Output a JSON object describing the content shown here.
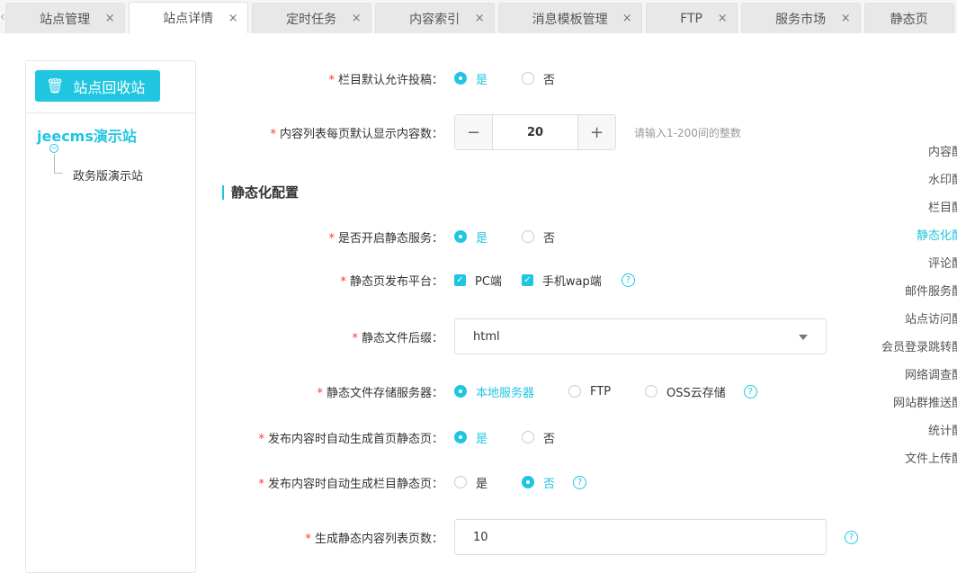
{
  "tabs": [
    {
      "label": "站点管理",
      "w": 133
    },
    {
      "label": "站点详情",
      "w": 133,
      "active": true
    },
    {
      "label": "定时任务",
      "w": 133
    },
    {
      "label": "内容索引",
      "w": 133
    },
    {
      "label": "消息模板管理",
      "w": 160
    },
    {
      "label": "FTP",
      "w": 102
    },
    {
      "label": "服务市场",
      "w": 133
    },
    {
      "label": "静态页",
      "w": 100
    }
  ],
  "sidebar": {
    "recycle_label": "站点回收站",
    "site": "jeecms演示站",
    "child": "政务版演示站"
  },
  "form": {
    "allow_submit": {
      "label": "栏目默认允许投稿：",
      "yes": "是",
      "no": "否"
    },
    "page_size": {
      "label": "内容列表每页默认显示内容数：",
      "value": "20",
      "hint": "请输入1-200间的整数",
      "minus": "−",
      "plus": "+"
    },
    "section": "静态化配置",
    "static_service": {
      "label": "是否开启静态服务：",
      "yes": "是",
      "no": "否"
    },
    "platform": {
      "label": "静态页发布平台：",
      "pc": "PC端",
      "wap": "手机wap端"
    },
    "suffix": {
      "label": "静态文件后缀：",
      "value": "html"
    },
    "storage": {
      "label": "静态文件存储服务器：",
      "local": "本地服务器",
      "ftp": "FTP",
      "oss": "OSS云存储"
    },
    "gen_index": {
      "label": "发布内容时自动生成首页静态页：",
      "yes": "是",
      "no": "否"
    },
    "gen_channel": {
      "label": "发布内容时自动生成栏目静态页：",
      "yes": "是",
      "no": "否"
    },
    "list_pages": {
      "label": "生成静态内容列表页数：",
      "value": "10"
    }
  },
  "anchors": [
    "内容配置",
    "水印配置",
    "栏目配置",
    "静态化配置",
    "评论配置",
    "邮件服务配置",
    "站点访问配置",
    "会员登录跳转配置",
    "网络调查配置",
    "网站群推送配置",
    "统计配置",
    "文件上传配置"
  ],
  "active_anchor": 3,
  "colors": {
    "accent": "#20c6e0",
    "required": "#ff3333"
  }
}
